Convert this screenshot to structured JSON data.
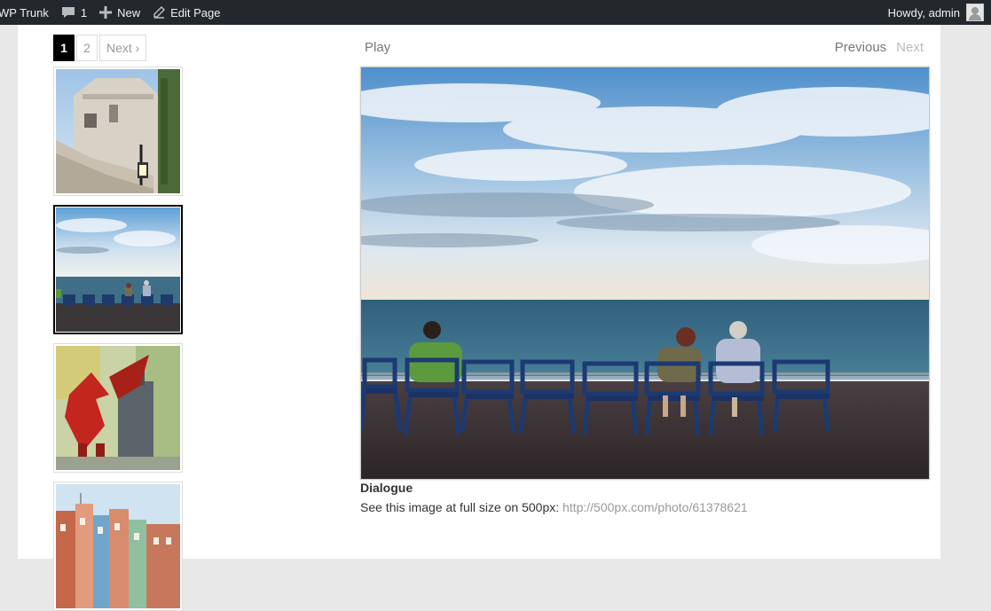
{
  "adminbar": {
    "site_name": "WP Trunk",
    "comments_count": "1",
    "new_label": "New",
    "edit_label": "Edit Page",
    "howdy": "Howdy, admin"
  },
  "pagination": {
    "pages": [
      "1",
      "2"
    ],
    "current": "1",
    "next_label": "Next ›"
  },
  "slideshow": {
    "play_label": "Play",
    "previous_label": "Previous",
    "next_label": "Next"
  },
  "thumbnails": [
    {
      "subject": "building-with-lamp",
      "active": false
    },
    {
      "subject": "seaside-chairs",
      "active": true
    },
    {
      "subject": "lego-dragon",
      "active": false
    },
    {
      "subject": "colorful-houses",
      "active": false
    }
  ],
  "caption": {
    "title": "Dialogue",
    "text_prefix": "See this image at full size on 500px: ",
    "link": "http://500px.com/photo/61378621"
  },
  "colors": {
    "adminbar_bg": "#23282d",
    "page_bg": "#ffffff",
    "outer_bg": "#e8e8e8",
    "active_border": "#000000",
    "link_gray": "#999999"
  }
}
